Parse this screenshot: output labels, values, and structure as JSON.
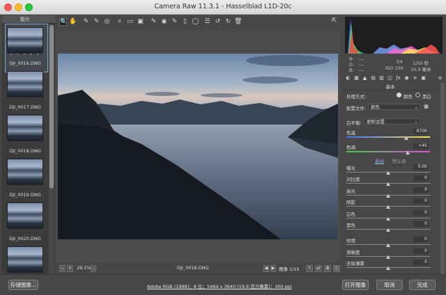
{
  "window": {
    "title": "Camera Raw 11.3.1 - Hasselblad L1D-20c"
  },
  "filmstrip": {
    "header": "胶片",
    "dots": "• • • • •",
    "items": [
      {
        "label": "DJI_0016.DNG",
        "selected": true
      },
      {
        "label": "DJI_0017.DNG",
        "selected": false
      },
      {
        "label": "DJI_0018.DNG",
        "selected": false
      },
      {
        "label": "DJI_0019.DNG",
        "selected": false
      },
      {
        "label": "DJI_0020.DNG",
        "selected": false
      },
      {
        "label": "",
        "selected": false
      }
    ]
  },
  "toolbar": {
    "tools": [
      "zoom-icon",
      "hand-icon",
      "eyedropper-icon",
      "color-sampler-icon",
      "target-adjust-icon",
      "crop-icon",
      "straighten-icon",
      "transform-icon",
      "spot-removal-icon",
      "red-eye-icon",
      "adjustment-brush-icon",
      "graduated-filter-icon",
      "radial-filter-icon",
      "preferences-icon",
      "rotate-ccw-icon",
      "rotate-cw-icon",
      "trash-icon"
    ],
    "glyphs": [
      "🔍",
      "✋",
      "✎",
      "✎",
      "◎",
      "⌗",
      "▭",
      "▣",
      "✎",
      "◉",
      "✎",
      "▯",
      "◯",
      "☰",
      "↺",
      "↻",
      "🗑"
    ]
  },
  "status": {
    "zoom": "29.1%",
    "filename": "DJI_0016.DNG",
    "image_counter": "图像 1/15"
  },
  "histogram_info": {
    "r": "R:",
    "g": "G:",
    "b": "B:",
    "r_val": "---",
    "g_val": "---",
    "b_val": "---",
    "aperture": "f/4",
    "shutter": "1/50 秒",
    "iso": "ISO 100",
    "focal": "10.3 毫米"
  },
  "basic": {
    "section_title": "基本",
    "treatment_label": "处理方式:",
    "color_option": "颜色",
    "bw_option": "黑白",
    "profile_label": "配置文件:",
    "profile_value": "颜色",
    "wb_label": "白平衡:",
    "wb_value": "原照设置",
    "temp_label": "色温",
    "temp_value": "6700",
    "temp_pos": 0.72,
    "tint_label": "色调",
    "tint_value": "+45",
    "tint_pos": 0.73,
    "auto": "自动",
    "default": "默认值",
    "sliders": [
      {
        "label": "曝光",
        "value": "0.00",
        "pos": 0.5
      },
      {
        "label": "对比度",
        "value": "0",
        "pos": 0.5
      },
      {
        "label": "高光",
        "value": "0",
        "pos": 0.5
      },
      {
        "label": "阴影",
        "value": "0",
        "pos": 0.5
      },
      {
        "label": "白色",
        "value": "0",
        "pos": 0.5
      },
      {
        "label": "黑色",
        "value": "0",
        "pos": 0.5
      },
      {
        "label": "纹理",
        "value": "0",
        "pos": 0.5
      },
      {
        "label": "清晰度",
        "value": "0",
        "pos": 0.5
      },
      {
        "label": "去除薄雾",
        "value": "0",
        "pos": 0.5
      }
    ]
  },
  "bottom": {
    "save_label": "存储图像...",
    "workflow": "Adobe RGB (1998)；8 位；5464 x 3640 (19.9 百万像素)；300 ppi",
    "open_label": "打开图像",
    "cancel_label": "取消",
    "done_label": "完成"
  },
  "colors": {
    "accent": "#7da5d8",
    "panel": "#474747",
    "close": "#fc5f57",
    "min": "#fdbc2e",
    "max": "#28c840"
  }
}
